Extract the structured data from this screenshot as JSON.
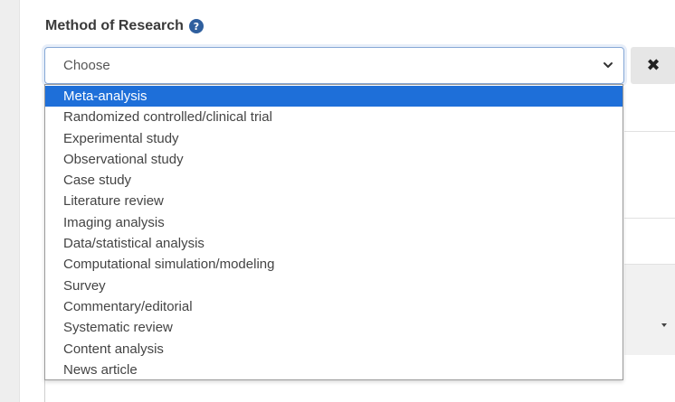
{
  "field": {
    "label": "Method of Research",
    "help_icon": "question-circle-icon"
  },
  "select": {
    "value": "Choose"
  },
  "clear_button": {
    "icon": "close-x-icon",
    "glyph": "✖"
  },
  "dropdown": {
    "selected_index": 0,
    "options": [
      "Meta-analysis",
      "Randomized controlled/clinical trial",
      "Experimental study",
      "Observational study",
      "Case study",
      "Literature review",
      "Imaging analysis",
      "Data/statistical analysis",
      "Computational simulation/modeling",
      "Survey",
      "Commentary/editorial",
      "Systematic review",
      "Content analysis",
      "News article"
    ]
  },
  "colors": {
    "highlight": "#1e6fd9",
    "help_icon": "#2f5f9e"
  }
}
